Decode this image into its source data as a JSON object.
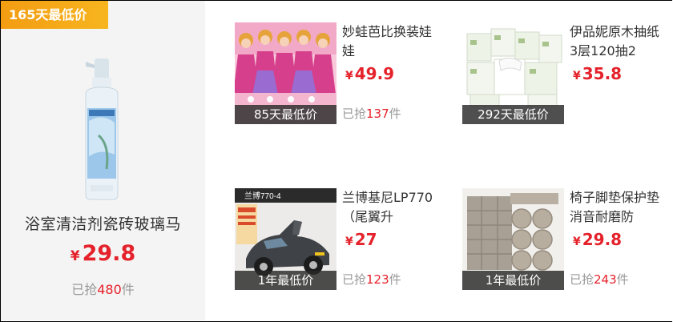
{
  "featured": {
    "badge": "165天最低价",
    "title": "浴室清洁剂瓷砖玻璃马",
    "currency": "¥",
    "price": "29.8",
    "sold_prefix": "已抢",
    "sold_count": "480",
    "sold_suffix": "件",
    "image_icon": "spray-bottle-icon"
  },
  "products": [
    {
      "title": "妙蛙芭比换装娃娃",
      "currency": "¥",
      "price": "49.9",
      "badge": "85天最低价",
      "sold_prefix": "已抢",
      "sold_count": "137",
      "sold_suffix": "件",
      "image_icon": "doll-set-image"
    },
    {
      "title": "伊品妮原木抽纸3层120抽2",
      "currency": "¥",
      "price": "35.8",
      "badge": "292天最低价",
      "sold_prefix": "",
      "sold_count": "",
      "sold_suffix": "",
      "image_icon": "tissue-pack-image"
    },
    {
      "title": "兰博基尼LP770（尾翼升",
      "currency": "¥",
      "price": "27",
      "badge": "1年最低价",
      "sold_prefix": "已抢",
      "sold_count": "123",
      "sold_suffix": "件",
      "image_icon": "toy-car-image",
      "image_text": "兰博770-4"
    },
    {
      "title": "椅子脚垫保护垫消音耐磨防",
      "currency": "¥",
      "price": "29.8",
      "badge": "1年最低价",
      "sold_prefix": "已抢",
      "sold_count": "243",
      "sold_suffix": "件",
      "image_icon": "felt-pads-image"
    }
  ]
}
